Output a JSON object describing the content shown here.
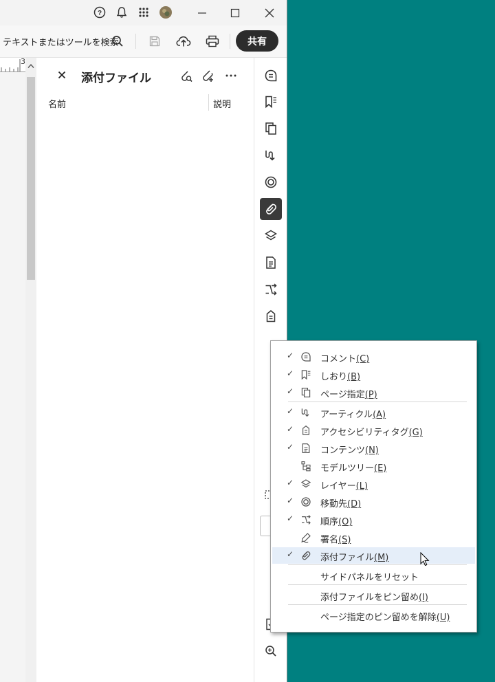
{
  "toolbar": {
    "search_placeholder": "テキストまたはツールを検索",
    "share_label": "共有"
  },
  "ruler": {
    "page_number": "3"
  },
  "panel": {
    "title": "添付ファイル",
    "columns": {
      "name": "名前",
      "description": "説明"
    }
  },
  "rail_icons": [
    "comment-icon",
    "bookmark-icon",
    "pages-icon",
    "articles-icon",
    "destinations-icon",
    "attachments-icon",
    "layers-icon",
    "content-icon",
    "order-icon",
    "tags-icon"
  ],
  "menu": {
    "items": [
      {
        "label": "コメント",
        "key": "(C)",
        "checked": true,
        "icon": "comment-icon"
      },
      {
        "label": "しおり",
        "key": "(B)",
        "checked": true,
        "icon": "bookmark-icon"
      },
      {
        "label": "ページ指定",
        "key": "(P)",
        "checked": true,
        "icon": "pages-icon"
      },
      {
        "label": "アーティクル",
        "key": "(A)",
        "checked": true,
        "icon": "articles-icon"
      },
      {
        "label": "アクセシビリティタグ",
        "key": "(G)",
        "checked": true,
        "icon": "tags-icon"
      },
      {
        "label": "コンテンツ",
        "key": "(N)",
        "checked": true,
        "icon": "content-icon"
      },
      {
        "label": "モデルツリー",
        "key": "(E)",
        "checked": false,
        "icon": "model-tree-icon"
      },
      {
        "label": "レイヤー",
        "key": "(L)",
        "checked": true,
        "icon": "layers-icon"
      },
      {
        "label": "移動先",
        "key": "(D)",
        "checked": true,
        "icon": "destinations-icon"
      },
      {
        "label": "順序",
        "key": "(O)",
        "checked": true,
        "icon": "order-icon"
      },
      {
        "label": "署名",
        "key": "(S)",
        "checked": false,
        "icon": "signature-icon"
      },
      {
        "label": "添付ファイル",
        "key": "(M)",
        "checked": true,
        "icon": "attachments-icon"
      }
    ],
    "actions": [
      {
        "label": "サイドパネルをリセット",
        "key": ""
      },
      {
        "label": "添付ファイルをピン留め",
        "key": "(I)"
      },
      {
        "label": "ページ指定のピン留めを解除",
        "key": "(U)"
      }
    ],
    "check_mark": "✓"
  },
  "colors": {
    "desktop": "#008080",
    "share_bg": "#2c2c2c",
    "highlight": "#e5eef9"
  }
}
